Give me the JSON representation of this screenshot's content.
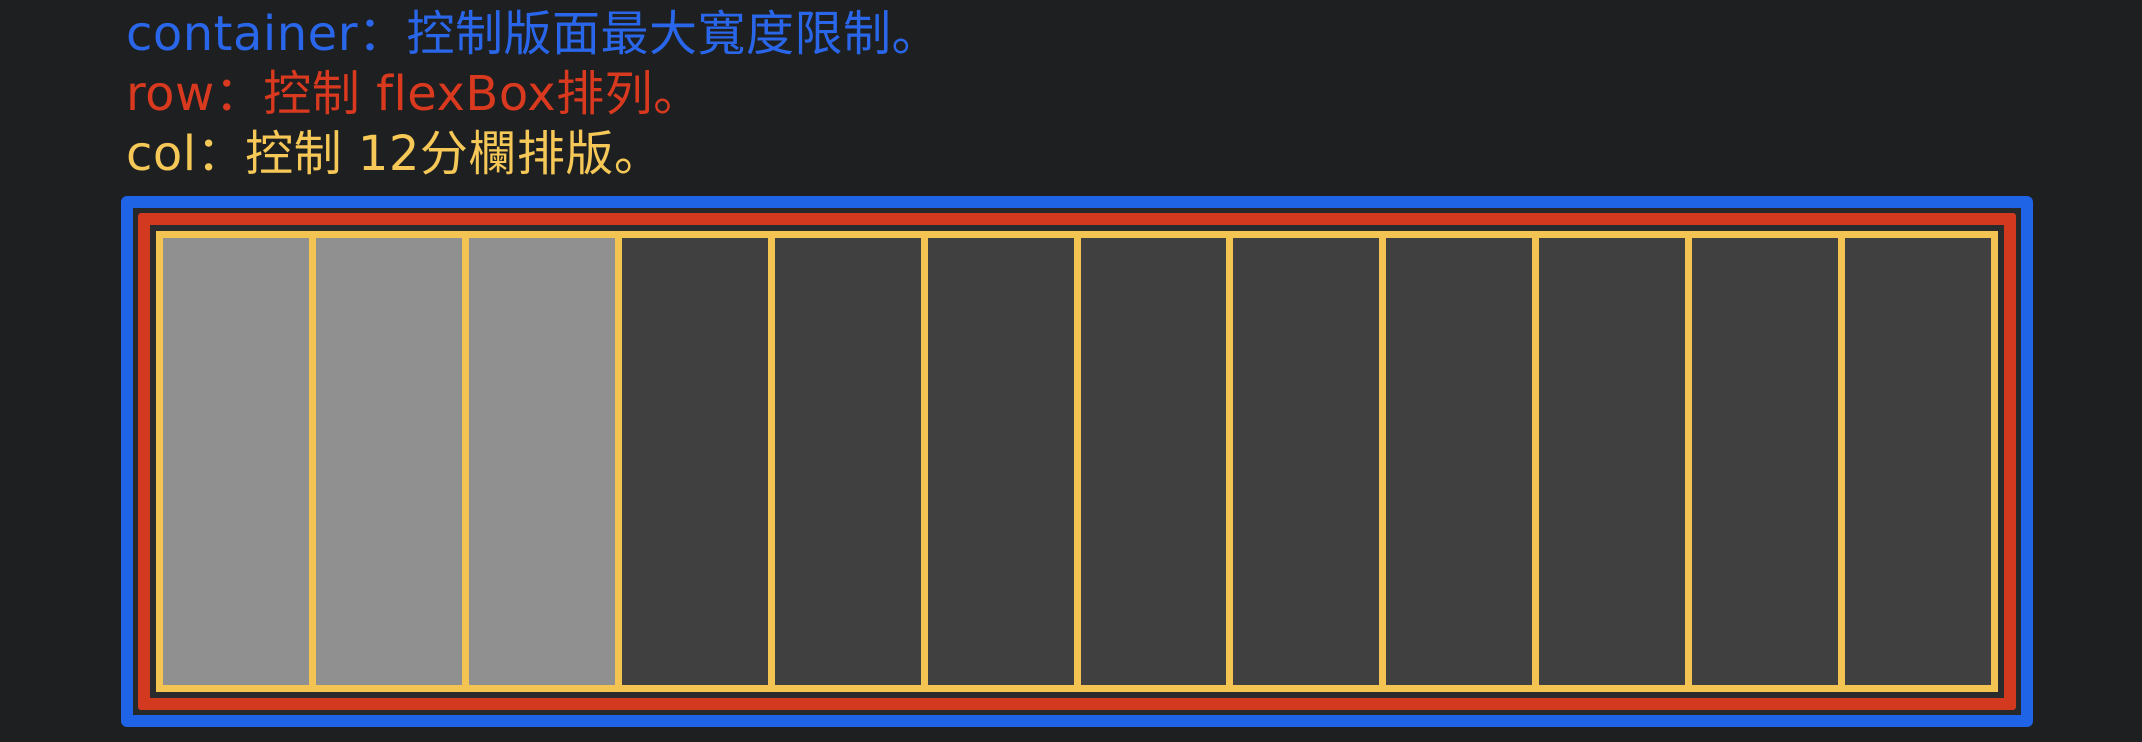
{
  "legend": {
    "container": {
      "text": "container：控制版面最大寬度限制。",
      "color": "#2a66ea"
    },
    "row": {
      "text": "row：控制 flexBox排列。",
      "color": "#d9391e"
    },
    "col": {
      "text": "col：控制 12分欄排版。",
      "color": "#f5c857"
    }
  },
  "colors": {
    "container_border": "#1f63e6",
    "row_border": "#d2391f",
    "col_border": "#f3c452",
    "col_active_fill": "#909090",
    "col_inactive_fill": "#404040",
    "background": "#1e1f21"
  },
  "grid": {
    "column_count": 12,
    "highlighted_columns": 3
  }
}
